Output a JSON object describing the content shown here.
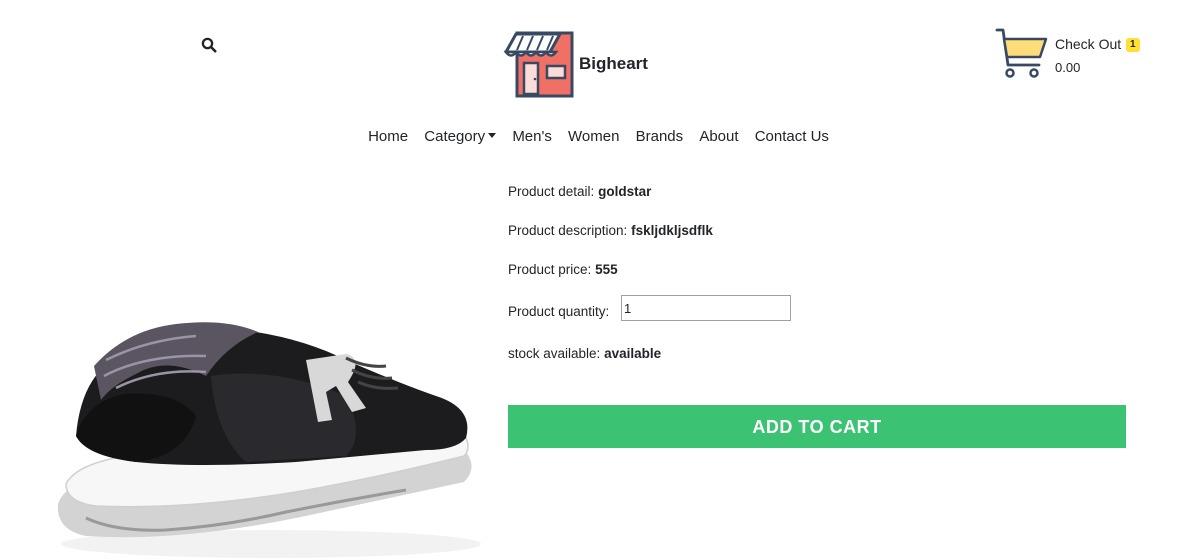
{
  "header": {
    "brand_name": "Bigheart",
    "search_icon": "search-icon",
    "logo_icon": "storefront-logo",
    "cart": {
      "icon": "shopping-cart-icon",
      "label": "Check Out",
      "badge_count": "1",
      "total": "0.00"
    }
  },
  "nav": {
    "items": [
      {
        "label": "Home"
      },
      {
        "label": "Category"
      },
      {
        "label": "Men's"
      },
      {
        "label": "Women"
      },
      {
        "label": "Brands"
      },
      {
        "label": "About"
      },
      {
        "label": "Contact Us"
      }
    ]
  },
  "product": {
    "image": "running-shoe-image",
    "detail_label": "Product detail:",
    "detail_value": "goldstar",
    "description_label": "Product description:",
    "description_value": "fskljdkljsdflk",
    "price_label": "Product price:",
    "price_value": "555",
    "quantity_label": "Product quantity:",
    "quantity_value": "1",
    "stock_label": "stock available:",
    "stock_value": "available",
    "add_to_cart_label": "ADD TO CART"
  },
  "colors": {
    "add_to_cart_bg": "#3cc273",
    "badge_bg": "#ffe033",
    "logo_red": "#f07065",
    "logo_navy": "#384a63",
    "cart_yellow": "#ffdc7a"
  }
}
